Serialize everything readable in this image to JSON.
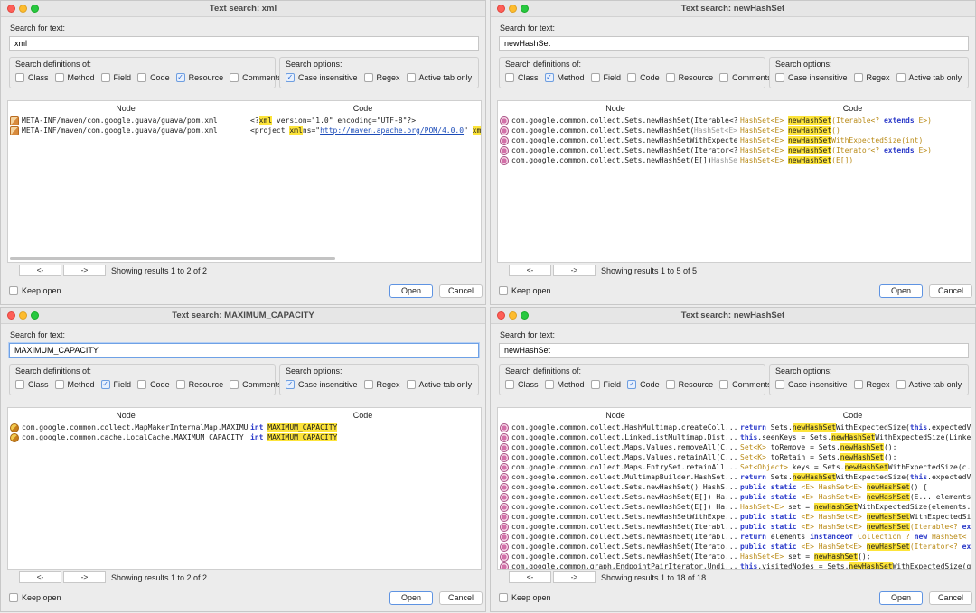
{
  "common": {
    "search_label": "Search for text:",
    "defs_title": "Search definitions of:",
    "opts_title": "Search options:",
    "node_header": "Node",
    "code_header": "Code",
    "prev_label": "<-",
    "next_label": "->",
    "keep_open_label": "Keep open",
    "open_label": "Open",
    "cancel_label": "Cancel",
    "def_labels": [
      "Class",
      "Method",
      "Field",
      "Code",
      "Resource",
      "Comments"
    ],
    "opt_labels": [
      "Case insensitive",
      "Regex",
      "Active tab only"
    ],
    "accent_color": "#fde43a"
  },
  "windows": [
    {
      "title": "Text search: xml",
      "query": "xml",
      "defs_checked": [
        false,
        false,
        false,
        false,
        true,
        false
      ],
      "opts_checked": [
        true,
        false,
        false
      ],
      "results_info": "Showing results 1 to 2 of 2",
      "rows": [
        {
          "icon": "resource-file-icon",
          "node": "META-INF/maven/com.google.guava/guava/pom.xml",
          "node_dim": "",
          "code": [
            [
              "",
              "<?"
            ],
            [
              "hl",
              "xml"
            ],
            [
              "",
              " version=\"1.0\" encoding=\"UTF-8\"?>"
            ]
          ]
        },
        {
          "icon": "resource-file-icon",
          "node": "META-INF/maven/com.google.guava/guava/pom.xml",
          "node_dim": "",
          "code": [
            [
              "",
              "<project "
            ],
            [
              "hl",
              "xml"
            ],
            [
              "",
              "ns=\""
            ],
            [
              "lnk",
              "http://maven.apache.org/POM/4.0.0"
            ],
            [
              "",
              "\" "
            ],
            [
              "hl",
              "xml"
            ],
            [
              "",
              "ns:xs"
            ]
          ]
        }
      ]
    },
    {
      "title": "Text search: newHashSet",
      "query": "newHashSet",
      "defs_checked": [
        false,
        true,
        false,
        false,
        false,
        false
      ],
      "opts_checked": [
        false,
        false,
        false
      ],
      "results_info": "Showing results 1 to 5 of 5",
      "rows": [
        {
          "icon": "method-icon",
          "node": "com.google.common.collect.Sets.newHashSet(Iterable<?",
          "node_dim": "",
          "code": [
            [
              "ty",
              "HashSet<E> "
            ],
            [
              "hl",
              "newHashSet"
            ],
            [
              "ty",
              "(Iterable<? "
            ],
            [
              "kw",
              "extends"
            ],
            [
              "ty",
              " E>)"
            ]
          ]
        },
        {
          "icon": "method-icon",
          "node": "com.google.common.collect.Sets.newHashSet() ",
          "node_dim": "HashSet<E>",
          "code": [
            [
              "ty",
              "HashSet<E> "
            ],
            [
              "hl",
              "newHashSet"
            ],
            [
              "ty",
              "()"
            ]
          ]
        },
        {
          "icon": "method-icon",
          "node": "com.google.common.collect.Sets.newHashSetWithExpected",
          "node_dim": "",
          "code": [
            [
              "ty",
              "HashSet<E> "
            ],
            [
              "hl",
              "newHashSet"
            ],
            [
              "ty",
              "WithExpectedSize(int)"
            ]
          ]
        },
        {
          "icon": "method-icon",
          "node": "com.google.common.collect.Sets.newHashSet(Iterator<?",
          "node_dim": "",
          "code": [
            [
              "ty",
              "HashSet<E> "
            ],
            [
              "hl",
              "newHashSet"
            ],
            [
              "ty",
              "(Iterator<? "
            ],
            [
              "kw",
              "extends"
            ],
            [
              "ty",
              " E>)"
            ]
          ]
        },
        {
          "icon": "method-icon",
          "node": "com.google.common.collect.Sets.newHashSet(E[]) ",
          "node_dim": "HashSe",
          "code": [
            [
              "ty",
              "HashSet<E> "
            ],
            [
              "hl",
              "newHashSet"
            ],
            [
              "ty",
              "(E[])"
            ]
          ]
        }
      ]
    },
    {
      "title": "Text search: MAXIMUM_CAPACITY",
      "query": "MAXIMUM_CAPACITY",
      "defs_checked": [
        false,
        false,
        true,
        false,
        false,
        false
      ],
      "opts_checked": [
        true,
        false,
        false
      ],
      "results_info": "Showing results 1 to 2 of 2",
      "rows": [
        {
          "icon": "field-icon",
          "node": "com.google.common.collect.MapMakerInternalMap.MAXIMUM",
          "node_dim": "",
          "code": [
            [
              "kw",
              "int "
            ],
            [
              "hl",
              "MAXIMUM_CAPACITY"
            ]
          ]
        },
        {
          "icon": "field-icon",
          "node": "com.google.common.cache.LocalCache.MAXIMUM_CAPACITY : ",
          "node_dim": "",
          "code": [
            [
              "kw",
              "int "
            ],
            [
              "hl",
              "MAXIMUM_CAPACITY"
            ]
          ]
        }
      ]
    },
    {
      "title": "Text search: newHashSet",
      "query": "newHashSet",
      "defs_checked": [
        false,
        false,
        false,
        true,
        false,
        false
      ],
      "opts_checked": [
        false,
        false,
        false
      ],
      "results_info": "Showing results 1 to 18 of 18",
      "rows": [
        {
          "icon": "method-icon",
          "node": "com.google.common.collect.HashMultimap.createColl...",
          "node_dim": "",
          "code": [
            [
              "kw",
              "return "
            ],
            [
              "",
              "Sets."
            ],
            [
              "hl",
              "newHashSet"
            ],
            [
              "",
              "WithExpectedSize("
            ],
            [
              "kw",
              "this"
            ],
            [
              "",
              ".expectedV"
            ]
          ]
        },
        {
          "icon": "method-icon",
          "node": "com.google.common.collect.LinkedListMultimap.Dist...",
          "node_dim": "",
          "code": [
            [
              "kw",
              "this"
            ],
            [
              "",
              ".seenKeys = Sets."
            ],
            [
              "hl",
              "newHashSet"
            ],
            [
              "",
              "WithExpectedSize(Linke"
            ]
          ]
        },
        {
          "icon": "method-icon",
          "node": "com.google.common.collect.Maps.Values.removeAll(C...",
          "node_dim": "",
          "code": [
            [
              "ty",
              "Set<K> "
            ],
            [
              "",
              "toRemove = Sets."
            ],
            [
              "hl",
              "newHashSet"
            ],
            [
              "",
              "();"
            ]
          ]
        },
        {
          "icon": "method-icon",
          "node": "com.google.common.collect.Maps.Values.retainAll(C...",
          "node_dim": "",
          "code": [
            [
              "ty",
              "Set<K> "
            ],
            [
              "",
              "toRetain = Sets."
            ],
            [
              "hl",
              "newHashSet"
            ],
            [
              "",
              "();"
            ]
          ]
        },
        {
          "icon": "method-icon",
          "node": "com.google.common.collect.Maps.EntrySet.retainAll...",
          "node_dim": "",
          "code": [
            [
              "ty",
              "Set<Object> "
            ],
            [
              "",
              "keys = Sets."
            ],
            [
              "hl",
              "newHashSet"
            ],
            [
              "",
              "WithExpectedSize(c."
            ]
          ]
        },
        {
          "icon": "method-icon",
          "node": "com.google.common.collect.MultimapBuilder.HashSet...",
          "node_dim": "",
          "code": [
            [
              "kw",
              "return "
            ],
            [
              "",
              "Sets."
            ],
            [
              "hl",
              "newHashSet"
            ],
            [
              "",
              "WithExpectedSize("
            ],
            [
              "kw",
              "this"
            ],
            [
              "",
              ".expectedV"
            ]
          ]
        },
        {
          "icon": "method-icon",
          "node": "com.google.common.collect.Sets.newHashSet() HashS...",
          "node_dim": "",
          "code": [
            [
              "kw",
              "public static "
            ],
            [
              "ty",
              "<E> HashSet<E> "
            ],
            [
              "hl",
              "newHashSet"
            ],
            [
              "",
              "() {"
            ]
          ]
        },
        {
          "icon": "method-icon",
          "node": "com.google.common.collect.Sets.newHashSet(E[]) Ha...",
          "node_dim": "",
          "code": [
            [
              "kw",
              "public static "
            ],
            [
              "ty",
              "<E> HashSet<E> "
            ],
            [
              "hl",
              "newHashSet"
            ],
            [
              "",
              "(E... elements"
            ]
          ]
        },
        {
          "icon": "method-icon",
          "node": "com.google.common.collect.Sets.newHashSet(E[]) Ha...",
          "node_dim": "",
          "code": [
            [
              "ty",
              "HashSet<E> "
            ],
            [
              "",
              "set = "
            ],
            [
              "hl",
              "newHashSet"
            ],
            [
              "",
              "WithExpectedSize(elements."
            ]
          ]
        },
        {
          "icon": "method-icon",
          "node": "com.google.common.collect.Sets.newHashSetWithExpe...",
          "node_dim": "",
          "code": [
            [
              "kw",
              "public static "
            ],
            [
              "ty",
              "<E> HashSet<E> "
            ],
            [
              "hl",
              "newHashSet"
            ],
            [
              "",
              "WithExpectedSi"
            ]
          ]
        },
        {
          "icon": "method-icon",
          "node": "com.google.common.collect.Sets.newHashSet(Iterabl...",
          "node_dim": "",
          "code": [
            [
              "kw",
              "public static "
            ],
            [
              "ty",
              "<E> HashSet<E> "
            ],
            [
              "hl",
              "newHashSet"
            ],
            [
              "ty",
              "(Iterable<? "
            ],
            [
              "kw",
              "ex"
            ]
          ]
        },
        {
          "icon": "method-icon",
          "node": "com.google.common.collect.Sets.newHashSet(Iterabl...",
          "node_dim": "",
          "code": [
            [
              "kw",
              "return "
            ],
            [
              "",
              "elements "
            ],
            [
              "kw",
              "instanceof "
            ],
            [
              "ty",
              "Collection ? "
            ],
            [
              "kw",
              "new "
            ],
            [
              "ty",
              "HashSet<"
            ]
          ]
        },
        {
          "icon": "method-icon",
          "node": "com.google.common.collect.Sets.newHashSet(Iterato...",
          "node_dim": "",
          "code": [
            [
              "kw",
              "public static "
            ],
            [
              "ty",
              "<E> HashSet<E> "
            ],
            [
              "hl",
              "newHashSet"
            ],
            [
              "ty",
              "(Iterator<? "
            ],
            [
              "kw",
              "ex"
            ]
          ]
        },
        {
          "icon": "method-icon",
          "node": "com.google.common.collect.Sets.newHashSet(Iterato...",
          "node_dim": "",
          "code": [
            [
              "ty",
              "HashSet<E> "
            ],
            [
              "",
              "set = "
            ],
            [
              "hl",
              "newHashSet"
            ],
            [
              "",
              "();"
            ]
          ]
        },
        {
          "icon": "method-icon",
          "node": "com.google.common.graph.EndpointPairIterator.Undi...",
          "node_dim": "",
          "code": [
            [
              "kw",
              "this"
            ],
            [
              "",
              ".visitedNodes = Sets."
            ],
            [
              "hl",
              "newHashSet"
            ],
            [
              "",
              "WithExpectedSize(g"
            ]
          ]
        }
      ]
    }
  ]
}
